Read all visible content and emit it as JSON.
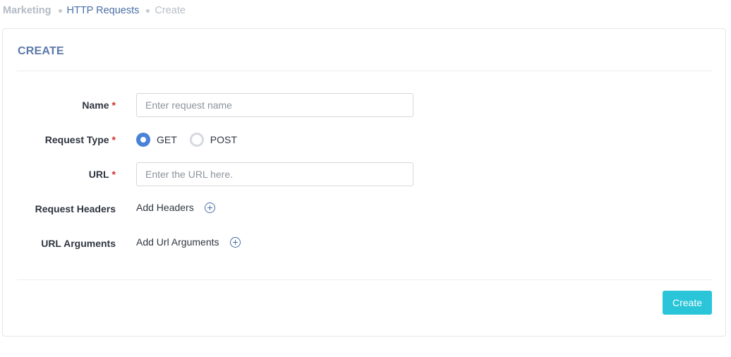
{
  "breadcrumb": {
    "root": "Marketing",
    "parent": "HTTP Requests",
    "current": "Create"
  },
  "card": {
    "title": "CREATE"
  },
  "form": {
    "name": {
      "label": "Name",
      "required_mark": "*",
      "value": "",
      "placeholder": "Enter request name"
    },
    "request_type": {
      "label": "Request Type",
      "required_mark": "*",
      "options": [
        "GET",
        "POST"
      ],
      "selected": "GET"
    },
    "url": {
      "label": "URL",
      "required_mark": "*",
      "value": "",
      "placeholder": "Enter the URL here."
    },
    "request_headers": {
      "label": "Request Headers",
      "action_label": "Add Headers",
      "icon": "add-circle-icon"
    },
    "url_arguments": {
      "label": "URL Arguments",
      "action_label": "Add Url Arguments",
      "icon": "add-circle-icon"
    }
  },
  "actions": {
    "create_label": "Create"
  },
  "colors": {
    "accent": "#4a82d8",
    "link": "#4a6fa5",
    "title": "#5b79a8",
    "button": "#2ac5d8",
    "required": "#d0302b"
  }
}
